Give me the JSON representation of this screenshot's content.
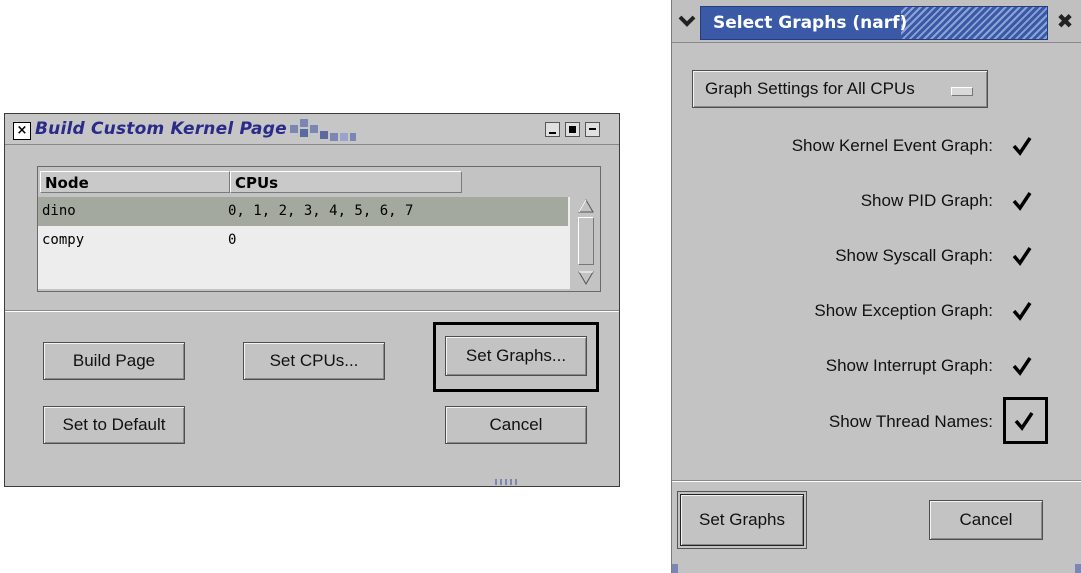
{
  "build_window": {
    "title": "Build Custom Kernel Page",
    "table": {
      "headers": [
        "Node",
        "CPUs"
      ],
      "rows": [
        {
          "node": "dino",
          "cpus": "0, 1, 2, 3, 4, 5, 6, 7",
          "selected": true
        },
        {
          "node": "compy",
          "cpus": "0",
          "selected": false
        }
      ]
    },
    "buttons": {
      "build_page": "Build Page",
      "set_cpus": "Set CPUs...",
      "set_graphs": "Set Graphs...",
      "set_default": "Set to Default",
      "cancel": "Cancel"
    }
  },
  "graphs_window": {
    "title": "Select Graphs (narf)",
    "menu_button": "Graph Settings for All CPUs",
    "options": [
      {
        "label": "Show Kernel Event Graph:",
        "checked": true
      },
      {
        "label": "Show PID Graph:",
        "checked": true
      },
      {
        "label": "Show Syscall Graph:",
        "checked": true
      },
      {
        "label": "Show Exception Graph:",
        "checked": true
      },
      {
        "label": "Show Interrupt Graph:",
        "checked": true
      },
      {
        "label": "Show Thread Names:",
        "checked": true
      }
    ],
    "buttons": {
      "set_graphs": "Set Graphs",
      "cancel": "Cancel"
    }
  },
  "colors": {
    "window_bg": "#c3c3c3",
    "title_blue": "#3a5aa8",
    "selected_row": "#a4a9a0"
  }
}
